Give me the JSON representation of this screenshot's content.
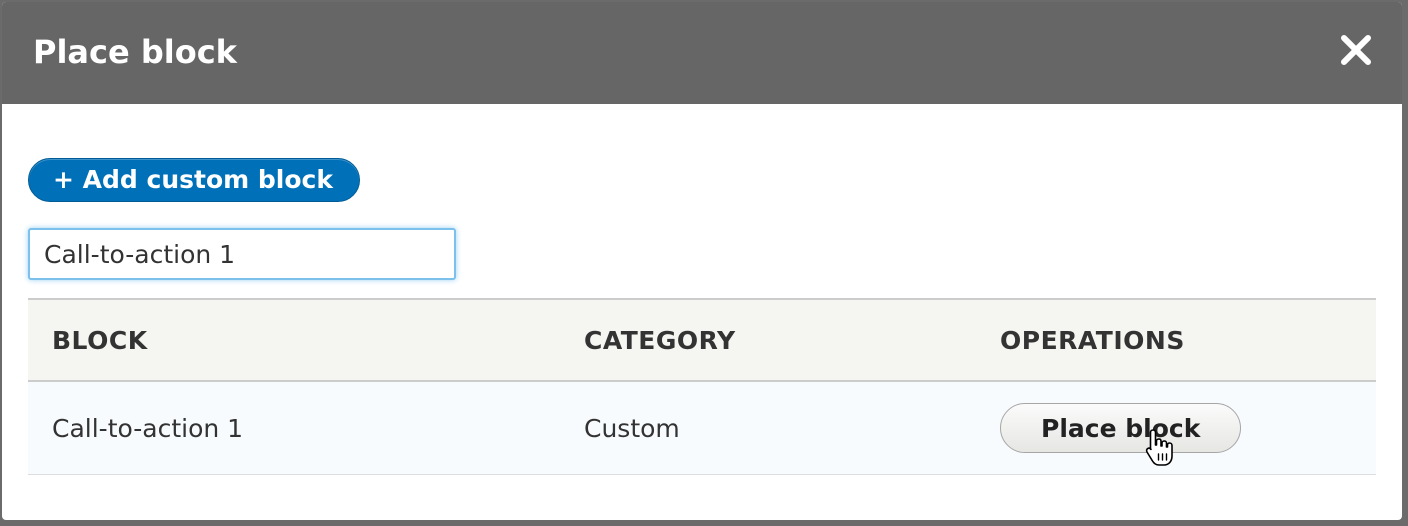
{
  "dialog": {
    "title": "Place block",
    "close_icon": "close-icon"
  },
  "toolbar": {
    "add_custom_block_label": "+ Add custom block"
  },
  "filter": {
    "value": "Call-to-action 1"
  },
  "table": {
    "headers": [
      "BLOCK",
      "CATEGORY",
      "OPERATIONS"
    ],
    "rows": [
      {
        "block": "Call-to-action 1",
        "category": "Custom",
        "operation_label": "Place block"
      }
    ]
  },
  "colors": {
    "titlebar": "#666666",
    "primary_button": "#0071b8",
    "focus_ring": "#7cc0ec"
  }
}
